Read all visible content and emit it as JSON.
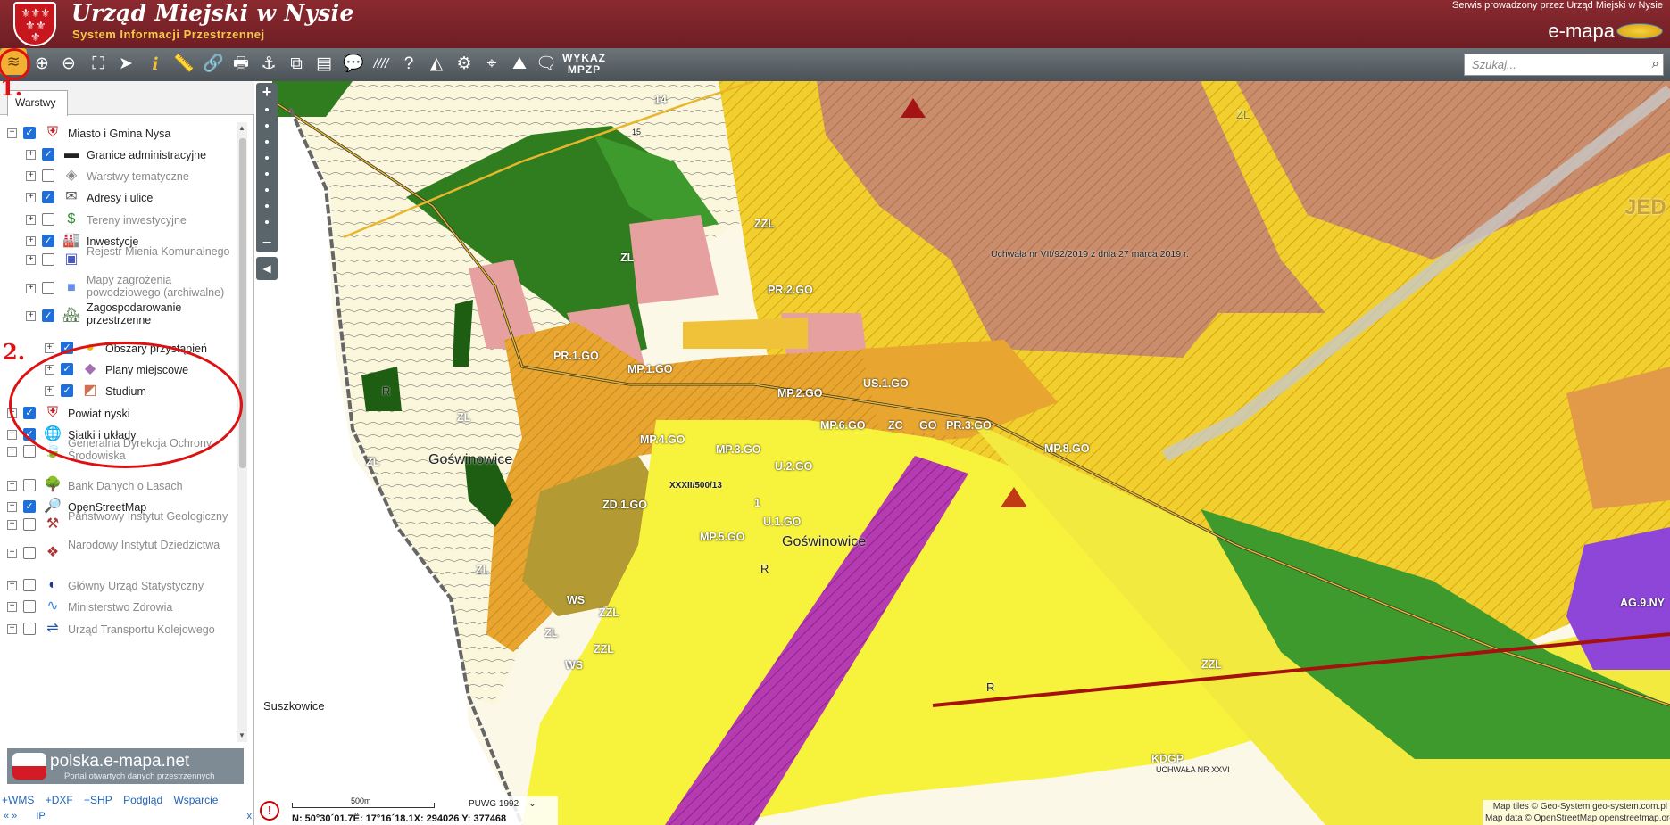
{
  "header": {
    "title": "Urząd Miejski w Nysie",
    "subtitle": "System Informacji Przestrzennej",
    "service_note": "Serwis prowadzony przez Urząd Miejski w Nysie",
    "brand": "e-mapa"
  },
  "toolbar": {
    "wykaz_label_1": "WYKAZ",
    "wykaz_label_2": "MPZP",
    "search_placeholder": "Szukaj..."
  },
  "sidebar": {
    "tab_label": "Warstwy",
    "items": [
      {
        "label": "Miasto i Gmina Nysa",
        "checked": true,
        "icon": "coat-of-arms-icon"
      },
      {
        "label": "Granice administracyjne",
        "checked": true,
        "icon": "border-line-icon"
      },
      {
        "label": "Warstwy tematyczne",
        "checked": false,
        "icon": "layers-stack-icon"
      },
      {
        "label": "Adresy i ulice",
        "checked": true,
        "icon": "envelope-icon"
      },
      {
        "label": "Tereny inwestycyjne",
        "checked": false,
        "icon": "dollar-icon"
      },
      {
        "label": "Inwestycje",
        "checked": true,
        "icon": "factory-icon"
      },
      {
        "label": "Rejestr Mienia Komunalnego",
        "checked": false,
        "icon": "registry-icon"
      },
      {
        "label": "Mapy zagrożenia powodziowego (archiwalne)",
        "checked": false,
        "icon": "flood-map-icon"
      },
      {
        "label": "Zagospodarowanie przestrzenne",
        "checked": true,
        "icon": "city-plan-icon"
      },
      {
        "label": "Obszary przystąpień",
        "checked": true,
        "icon": "area-blob-icon"
      },
      {
        "label": "Plany miejscowe",
        "checked": true,
        "icon": "local-plan-icon"
      },
      {
        "label": "Studium",
        "checked": true,
        "icon": "study-icon"
      },
      {
        "label": "Powiat nyski",
        "checked": true,
        "icon": "county-icon"
      },
      {
        "label": "Siatki i układy",
        "checked": true,
        "icon": "globe-grid-icon"
      },
      {
        "label": "Generalna Dyrekcja Ochrony Środowiska",
        "checked": false,
        "icon": "leaf-icon"
      },
      {
        "label": "Bank Danych o Lasach",
        "checked": false,
        "icon": "tree-icon"
      },
      {
        "label": "OpenStreetMap",
        "checked": true,
        "icon": "magnifier-map-icon"
      },
      {
        "label": "Państwowy Instytut Geologiczny",
        "checked": false,
        "icon": "geology-icon"
      },
      {
        "label": "Narodowy Instytut Dziedzictwa",
        "checked": false,
        "icon": "heritage-icon"
      },
      {
        "label": "Główny Urząd Statystyczny",
        "checked": false,
        "icon": "statistics-icon"
      },
      {
        "label": "Ministerstwo Zdrowia",
        "checked": false,
        "icon": "wave-icon"
      },
      {
        "label": "Urząd Transportu Kolejowego",
        "checked": false,
        "icon": "rail-icon"
      }
    ],
    "portal_name": "polska.e-mapa.net",
    "portal_sub": "Portal otwartych danych przestrzennych",
    "links": [
      "+WMS",
      "+DXF",
      "+SHP",
      "Podgląd",
      "Wsparcie"
    ],
    "row2_left": "« »",
    "row2_mid": "IP",
    "row2_close": "x"
  },
  "map": {
    "labels": {
      "zl1": "ZL",
      "zzl1": "ZZL",
      "pr2go": "PR.2.GO",
      "pr1go": "PR.1.GO",
      "mp1go": "MP.1.GO",
      "mp2go": "MP.2.GO",
      "us1go": "US.1.GO",
      "mp6go": "MP.6.GO",
      "zc": "ZC",
      "go": "GO",
      "pr3go": "PR.3.GO",
      "mp8go": "MP.8.GO",
      "mp4go": "MP.4.GO",
      "mp3go": "MP.3.GO",
      "u2go": "U.2.GO",
      "xxxii": "XXXII/500/13",
      "zd1go": "ZD.1.GO",
      "u1go": "U.1.GO",
      "mp5go": "MP.5.GO",
      "goswinowice1": "Goświnowice",
      "goswinowice2": "Goświnowice",
      "r1": "R",
      "r2": "R",
      "r3": "R",
      "zl2": "ZL",
      "zl3": "ZL",
      "zl4": "ZL",
      "zl5": "ZL",
      "ws1": "WS",
      "ws2": "WS",
      "zzl2": "ZZL",
      "zzl3": "ZZL",
      "zzl4": "ZZL",
      "suszkowice": "Suszkowice",
      "uchwala": "Uchwała nr VII/92/2019 z dnia 27 marca 2019 r.",
      "jed": "JED",
      "kdgp": "KDGP",
      "num14": "14",
      "num1": "1",
      "num15": "15",
      "zl6": "ZL",
      "ag": "AG.9.NY",
      "uchwala_bottom": "UCHWAŁA NR XXVI"
    },
    "scale_label": "500m",
    "crs": "PUWG 1992",
    "coords": "N: 50°30´01.7Ë: 17°16´18.1X: 294026   Y: 377468",
    "attribution_1": "Map tiles © Geo-System geo-system.com.pl",
    "attribution_2": "Map data © OpenStreetMap openstreetmap.org/copyright"
  },
  "annotations": {
    "one": "1.",
    "two": "2."
  },
  "colors": {
    "header": "#7a242a",
    "toolbar": "#5a6268",
    "accent": "#1e6fd9",
    "annotation": "#dd1111"
  }
}
